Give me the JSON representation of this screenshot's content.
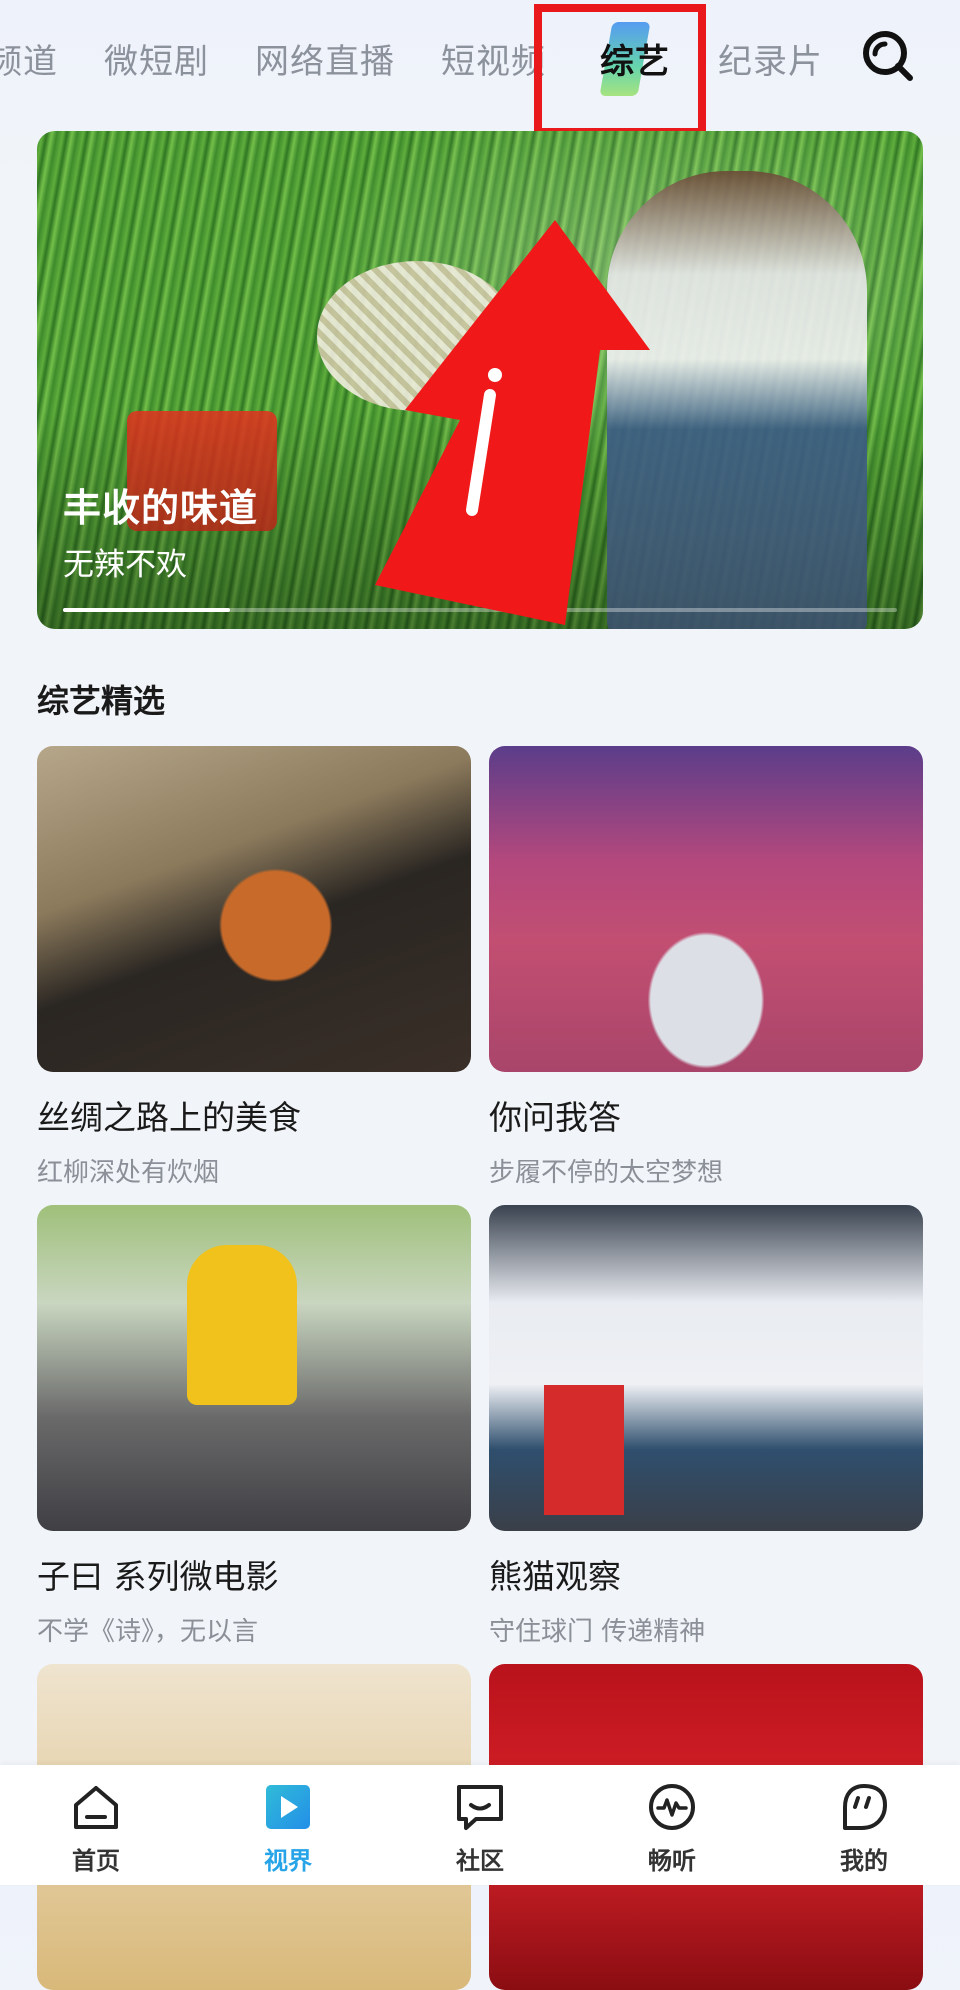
{
  "top_tabs": [
    "频道",
    "微短剧",
    "网络直播",
    "短视频",
    "综艺",
    "纪录片"
  ],
  "active_tab_index": 4,
  "banner": {
    "title": "丰收的味道",
    "subtitle": "无辣不欢",
    "slide_progress": 0.2
  },
  "section": {
    "title": "综艺精选"
  },
  "cards": [
    {
      "title": "丝绸之路上的美食",
      "subtitle": "红柳深处有炊烟"
    },
    {
      "title": "你问我答",
      "subtitle": "步履不停的太空梦想"
    },
    {
      "title": "子曰 系列微电影",
      "subtitle": "不学《诗》，无以言"
    },
    {
      "title": "熊猫观察",
      "subtitle": "守住球门 传递精神"
    },
    {
      "title": "",
      "subtitle": ""
    },
    {
      "title": "",
      "subtitle": ""
    }
  ],
  "bottom_nav": [
    {
      "label": "首页",
      "icon": "home-icon"
    },
    {
      "label": "视界",
      "icon": "play-icon"
    },
    {
      "label": "社区",
      "icon": "chat-icon"
    },
    {
      "label": "畅听",
      "icon": "audio-wave-icon"
    },
    {
      "label": "我的",
      "icon": "profile-icon"
    }
  ],
  "active_nav_index": 1,
  "colors": {
    "accent": "#27a4e8",
    "highlight": "#e8181b"
  }
}
